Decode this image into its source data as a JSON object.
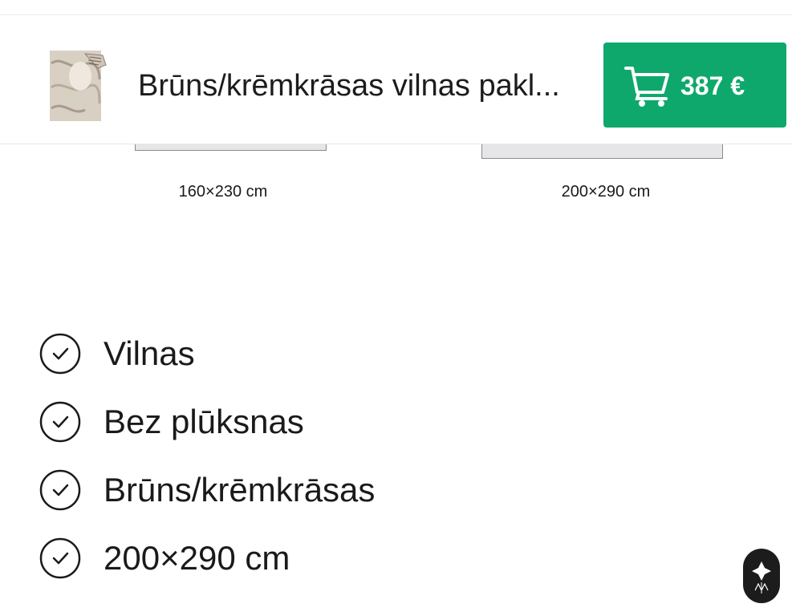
{
  "header": {
    "product_title": "Brūns/krēmkrāsas vilnas pakl...",
    "thumbnail_icon": "rug-thumbnail",
    "cart_button": {
      "icon": "cart-icon",
      "price": "387 €"
    },
    "accent_color": "#0fa86c"
  },
  "sizes": [
    {
      "label": "160×230 cm"
    },
    {
      "label": "200×290 cm"
    }
  ],
  "features": [
    {
      "icon": "check-circle-icon",
      "text": "Vilnas"
    },
    {
      "icon": "check-circle-icon",
      "text": "Bez plūksnas"
    },
    {
      "icon": "check-circle-icon",
      "text": "Brūns/krēmkrāsas"
    },
    {
      "icon": "check-circle-icon",
      "text": "200×290 cm"
    }
  ],
  "floating": {
    "icon": "brand-logo-icon"
  }
}
